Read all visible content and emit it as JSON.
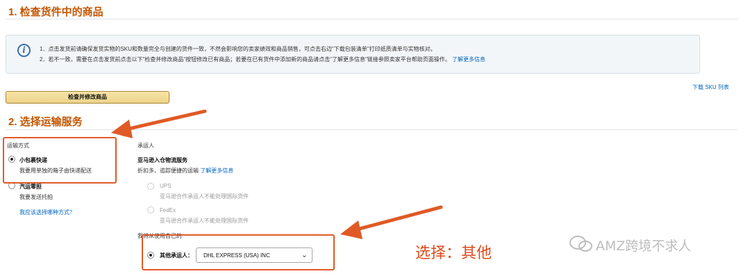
{
  "section1": {
    "title": "1. 检查货件中的商品",
    "info": {
      "icon": "info-icon",
      "line1": "1．点击发货前请确保发货实物的SKU和数量完全与创建的货件一致，不然会影响您的卖家绩效和商品销售，可点击右边\"下载包装清单\"打印纸质清单与实物核对。",
      "line2": "2．若不一致，需要在点击发货前点击以下\"检查并修改商品\"按钮修改已有商品；若要在已有货件中添加新的商品请点击\"了解更多信息\"链接参照卖家平台帮助页面操作。",
      "link": "了解更多信息"
    },
    "check_button": "检查并修改商品",
    "download_sku": "下载 SKU 列表"
  },
  "section2": {
    "title": "2. 选择运输服务",
    "shipping_method": {
      "label": "运输方式",
      "options": [
        {
          "title": "小包裹快递",
          "sub": "我要用单独的箱子由快递配送",
          "selected": true
        },
        {
          "title": "汽运零担",
          "sub": "我要发送托拍",
          "selected": false
        }
      ],
      "help_link": "我应该选择哪种方式？"
    },
    "carrier": {
      "label": "承运人",
      "partnered_title": "亚马逊入仓物流服务",
      "partnered_sub": "折扣多、追踪便捷的运输",
      "partnered_link": "了解更多信息",
      "carriers": [
        {
          "name": "UPS",
          "note": "亚马逊合作承运人不能处理国际货件"
        },
        {
          "name": "FedEx",
          "note": "亚马逊合作承运人不能处理国际货件"
        }
      ],
      "non_partnered_title": "我将从使用自己的",
      "other_label": "其他承运人：",
      "other_value": "DHL EXPRESS (USA) INC"
    }
  },
  "annotation": {
    "callout": "选择：其他",
    "color": "#e05a25"
  },
  "watermark": {
    "text": "AMZ跨境不求人",
    "icon": "wechat-icon"
  }
}
